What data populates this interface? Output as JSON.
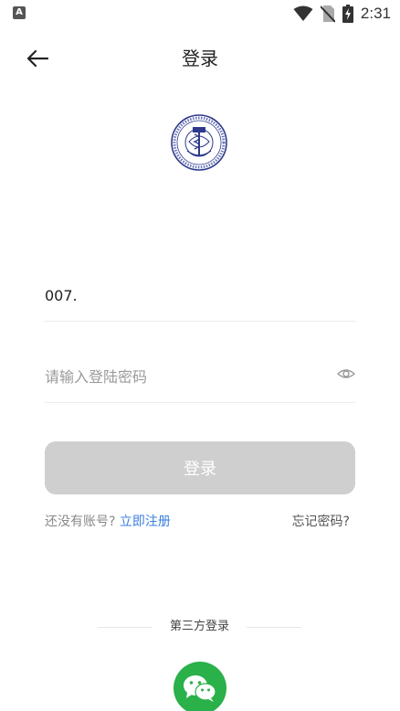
{
  "status_bar": {
    "app_icon_letter": "A",
    "time": "2:31",
    "icons": [
      "wifi-icon",
      "no-sim-icon",
      "battery-charging-icon"
    ]
  },
  "header": {
    "title": "登录",
    "back_icon": "arrow-left-icon"
  },
  "logo": {
    "icon": "organization-seal-logo"
  },
  "form": {
    "account_value": "007.",
    "password_placeholder": "请输入登陆密码",
    "password_toggle_icon": "eye-icon",
    "login_button_label": "登录"
  },
  "links": {
    "no_account_text": "还没有账号?",
    "register_label": "立即注册",
    "forgot_label": "忘记密码?"
  },
  "third_party": {
    "label": "第三方登录",
    "wechat_icon": "wechat-icon"
  },
  "colors": {
    "accent_link": "#3a7fe0",
    "button_disabled": "#cfcfcf",
    "wechat_green": "#2ab14a",
    "logo_blue": "#2d3a8c"
  }
}
